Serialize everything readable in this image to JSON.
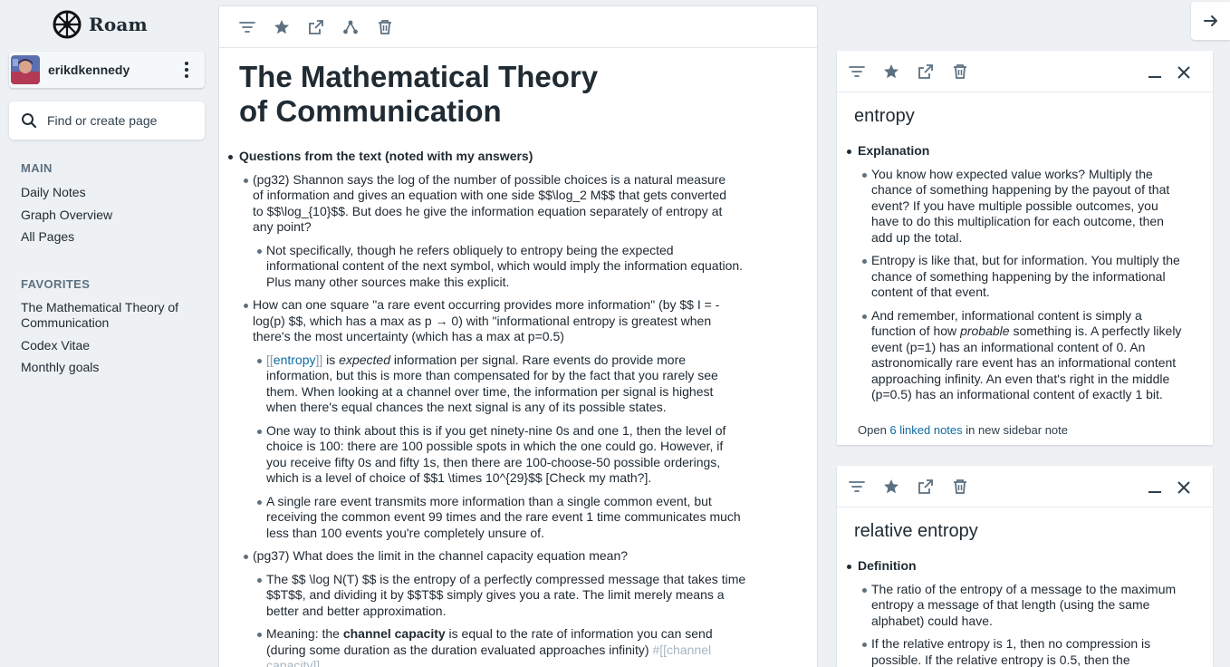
{
  "brand": {
    "name": "Roam"
  },
  "user": {
    "name": "erikdkennedy"
  },
  "search": {
    "placeholder": "Find or create page"
  },
  "nav": {
    "main_title": "MAIN",
    "main_items": [
      "Daily Notes",
      "Graph Overview",
      "All Pages"
    ],
    "favorites_title": "FAVORITES",
    "favorites": [
      "The Mathematical Theory of Communication",
      "Codex Vitae",
      "Monthly goals"
    ]
  },
  "page": {
    "title": "The Mathematical Theory of Communication",
    "b1": "Questions from the text (noted with my answers)",
    "b2": "(pg32) Shannon says the log of the number of possible choices is a natural measure of information and gives an equation with one side $$\\log_2 M$$ that gets converted to $$\\log_{10}$$. But does he give the information equation separately of entropy at any point?",
    "b3": "Not specifically, though he refers obliquely to entropy being the expected informational content of the next symbol, which would imply the information equation. Plus many other sources make this explicit.",
    "b4": "How can one square \"a rare event occurring provides more information\" (by $$ I = -log(p) $$, which has a max as p → 0) with \"informational entropy is greatest when there's the most uncertainty (which has a max at p=0.5)",
    "b5_ref_open": "[[",
    "b5_ref": "entropy",
    "b5_ref_close": "]]",
    "b5_is": " is ",
    "b5_em": "expected",
    "b5_rest": " information per signal. Rare events do provide more information, but this is more than compensated for by the fact that you rarely see them. When looking at a channel over time, the information per signal is highest when there's equal chances the next signal is any of its possible states.",
    "b6": "One way to think about this is if you get ninety-nine 0s and one 1, then the level of choice is 100: there are 100 possible spots in which the one could go. However, if you receive fifty 0s and fifty 1s, then there are 100-choose-50 possible orderings, which is a level of choice of $$1 \\times 10^{29}$$ [Check my math?].",
    "b7": "A single rare event transmits more information than a single common event, but receiving the common event 99 times and the rare event 1 time communicates much less than 100 events you're completely unsure of.",
    "b8": "(pg37) What does the limit in the channel capacity equation mean?",
    "b9": "The $$ \\log N(T) $$ is the entropy of a perfectly compressed message that takes time $$T$$, and dividing it by $$T$$ simply gives you a rate. The limit merely means a better and better approximation.",
    "b10_pre": "Meaning: the ",
    "b10_bold": "channel capacity",
    "b10_post": " is equal to the rate of information you can send (during some duration as the duration evaluated approaches infinity) ",
    "b10_tag": "#[[channel capacity]]"
  },
  "card1": {
    "title": "entropy",
    "heading": "Explanation",
    "p1": "You know how expected value works? Multiply the chance of something happening by the payout of that event? If you have multiple possible outcomes, you have to do this multiplication for each outcome, then add up the total.",
    "p2": "Entropy is like that, but for information. You multiply the chance of something happening by the informational content of that event.",
    "p3_pre": "And remember, informational content is simply a function of how ",
    "p3_em": "probable",
    "p3_post": " something is. A perfectly likely event (p=1) has an informational content of 0. An astronomically rare event has an informational content approaching infinity. An even that's right in the middle (p=0.5) has an informational content of exactly 1 bit.",
    "footer_pre": "Open ",
    "footer_link": "6 linked notes",
    "footer_post": " in new sidebar note"
  },
  "card2": {
    "title": "relative entropy",
    "heading": "Definition",
    "p1": "The ratio of the entropy of a message to the maximum entropy a message of that length (using the same alphabet) could have.",
    "p2": "If the relative entropy is 1, then no compression is possible. If the relative entropy is 0.5, then the"
  },
  "colors": {
    "accent": "#106ba3",
    "text": "#202b33",
    "muted": "#5c7080",
    "background": "#eef1f4"
  },
  "icons": [
    "filter-icon",
    "star-icon",
    "open-external-icon",
    "graph-icon",
    "trash-icon",
    "minimize-icon",
    "close-icon",
    "arrow-right-icon",
    "search-icon",
    "kebab-icon"
  ]
}
